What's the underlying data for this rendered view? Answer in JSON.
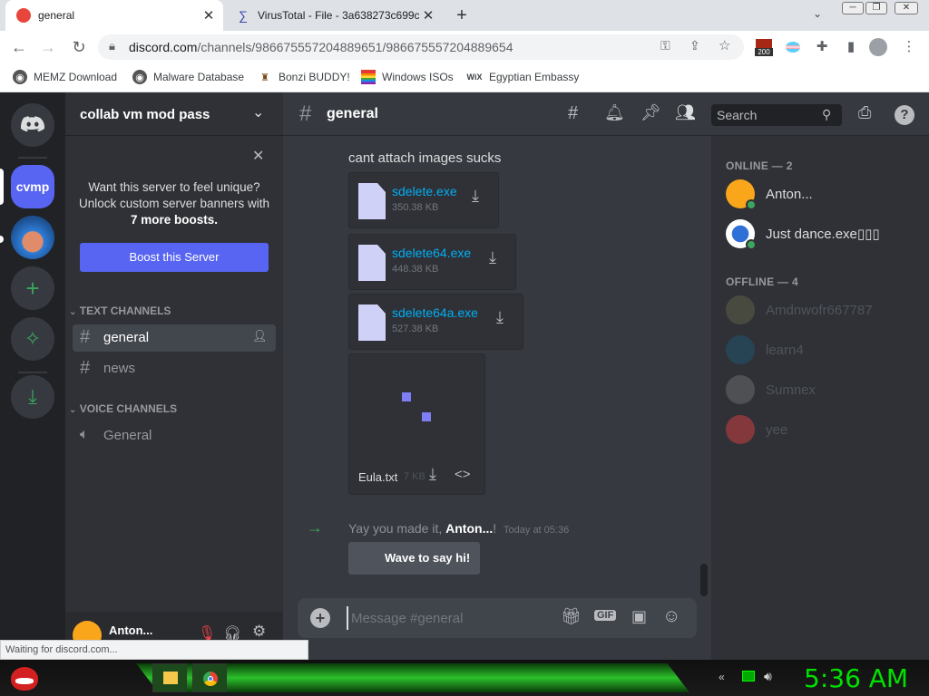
{
  "browser": {
    "tabs": [
      {
        "title": "general"
      },
      {
        "title": "VirusTotal - File - 3a638273c699c"
      }
    ],
    "url_domain": "discord.com",
    "url_path": "/channels/986675557204889651/986675557204889654",
    "ext_badge": "200",
    "bookmarks": [
      {
        "label": "MEMZ Download"
      },
      {
        "label": "Malware Database"
      },
      {
        "label": "Bonzi BUDDY!"
      },
      {
        "label": "Windows ISOs"
      },
      {
        "label": "Egyptian Embassy"
      }
    ],
    "status_text": "Waiting for discord.com..."
  },
  "discord": {
    "server_name": "collab vm mod pass",
    "server_abbr": "cvmp",
    "boost_promo": {
      "line1": "Want this server to feel unique?",
      "line2": "Unlock custom server banners with",
      "line3": "7 more boosts.",
      "button": "Boost this Server"
    },
    "categories": {
      "text": "TEXT CHANNELS",
      "voice": "VOICE CHANNELS"
    },
    "text_channels": [
      {
        "name": "general"
      },
      {
        "name": "news"
      }
    ],
    "voice_channels": [
      {
        "name": "General"
      }
    ],
    "user_panel_name": "Anton...",
    "channel_title": "general",
    "search_placeholder": "Search",
    "messages": {
      "text": "cant attach images sucks",
      "attachments": [
        {
          "name": "sdelete.exe",
          "size": "350.38 KB"
        },
        {
          "name": "sdelete64.exe",
          "size": "448.38 KB"
        },
        {
          "name": "sdelete64a.exe",
          "size": "527.38 KB"
        }
      ],
      "text_file": {
        "name": "Eula.txt",
        "size": "7 KB"
      },
      "system": {
        "prefix": "Yay you made it, ",
        "user": "Anton...",
        "suffix": "!",
        "timestamp": "Today at 05:36",
        "wave_button": "Wave to say hi!"
      }
    },
    "composer_placeholder": "Message #general",
    "gif_label": "GIF",
    "members": {
      "online_header": "ONLINE — 2",
      "offline_header": "OFFLINE — 4",
      "online": [
        {
          "name": "Anton..."
        },
        {
          "name": "Just dance.exe▯▯▯"
        }
      ],
      "offline": [
        {
          "name": "Amdnwofr667787"
        },
        {
          "name": "learn4"
        },
        {
          "name": "Sumnex"
        },
        {
          "name": "yee"
        }
      ]
    }
  },
  "taskbar": {
    "clock": "5:36 AM"
  },
  "colors": {
    "blurple": "#5865f2",
    "discord_bg": "#36393f",
    "sidebar_bg": "#2f3136",
    "server_bar_bg": "#202225",
    "online_green": "#3ba55d",
    "link_blue": "#00aff4",
    "taskbar_green": "#2bc02b"
  }
}
